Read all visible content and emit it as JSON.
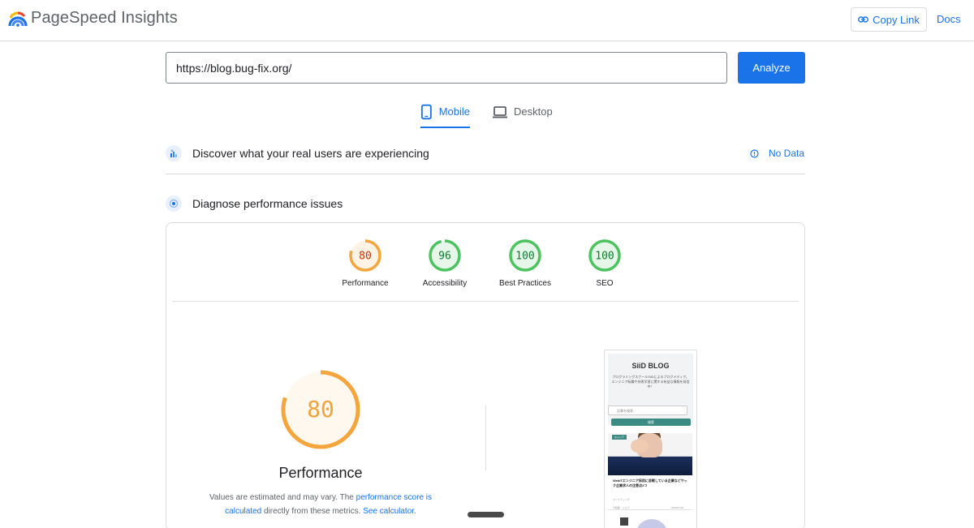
{
  "header": {
    "app_title": "PageSpeed Insights",
    "copy_link_label": "Copy Link",
    "docs_label": "Docs",
    "logo_icon": "pagespeed-logo-icon"
  },
  "search": {
    "url_value": "https://blog.bug-fix.org/",
    "analyze_label": "Analyze"
  },
  "tabs": [
    {
      "label": "Mobile",
      "icon": "phone-icon",
      "active": true
    },
    {
      "label": "Desktop",
      "icon": "laptop-icon",
      "active": false
    }
  ],
  "field_data": {
    "title": "Discover what your real users are experiencing",
    "status_label": "No Data",
    "status_icon": "info-icon"
  },
  "lab_data": {
    "title": "Diagnose performance issues"
  },
  "scores": [
    {
      "label": "Performance",
      "value": "80",
      "fraction": 0.8,
      "color": "#f4a53d",
      "text_color": "#c33300",
      "bg": "#fff3e5"
    },
    {
      "label": "Accessibility",
      "value": "96",
      "fraction": 0.96,
      "color": "#4dc35f",
      "text_color": "#0a7d2e",
      "bg": "#e6f6e8"
    },
    {
      "label": "Best Practices",
      "value": "100",
      "fraction": 1.0,
      "color": "#4dc35f",
      "text_color": "#0a7d2e",
      "bg": "#e6f6e8"
    },
    {
      "label": "SEO",
      "value": "100",
      "fraction": 1.0,
      "color": "#4dc35f",
      "text_color": "#0a7d2e",
      "bg": "#e6f6e8"
    }
  ],
  "performance_detail": {
    "score": "80",
    "fraction": 0.8,
    "title": "Performance",
    "note_pre": "Values are estimated and may vary. The",
    "note_link1": "performance score is calculated",
    "note_mid": "directly from these metrics.",
    "note_link2": "See calculator."
  },
  "screenshot": {
    "blog_title": "SiiD BLOG",
    "blog_sub_1": "プログラミングスクールSiiDによるブログメディア。",
    "blog_sub_2": "エンジニア転職や技術学習に関する有益な情報を発信中！",
    "search_placeholder": "記事を検索...",
    "search_btn": "検索",
    "tag": "キャリア",
    "post_title": "WebITエンジニア採用に苦戦している企業などサック企業求人の注意点3つ",
    "post_meta": "マーケティング",
    "foot_left": "IT転職・ジョブ",
    "foot_right": "2023/07/18"
  },
  "colors": {
    "accent": "#1a73e8",
    "average": "#f4a53d",
    "pass": "#4dc35f"
  }
}
